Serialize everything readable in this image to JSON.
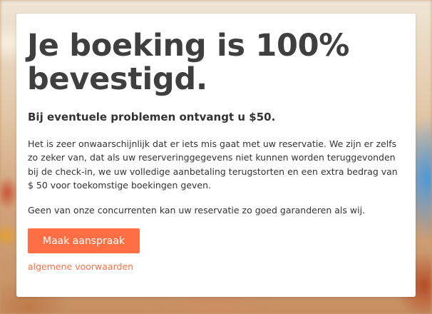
{
  "card": {
    "headline": "Je boeking is 100% bevestigd.",
    "subheading": "Bij eventuele problemen ontvangt u $50.",
    "paragraph_1": "Het is zeer onwaarschijnlijk dat er iets mis gaat met uw reservatie. We zijn er zelfs zo zeker van, dat als uw reserveringgegevens niet kunnen worden teruggevonden bij de check-in, we uw volledige aanbetaling terugstorten en een extra bedrag van $ 50 voor toekomstige boekingen geven.",
    "paragraph_2": "Geen van onze concurrenten kan uw reservatie zo goed garanderen als wij.",
    "claim_button_label": "Maak aanspraak",
    "terms_link_label": "algemene voorwaarden"
  },
  "colors": {
    "accent": "#ff6f43",
    "heading_text": "#3f3f3f",
    "body_text": "#333333",
    "card_background": "#ffffff"
  }
}
